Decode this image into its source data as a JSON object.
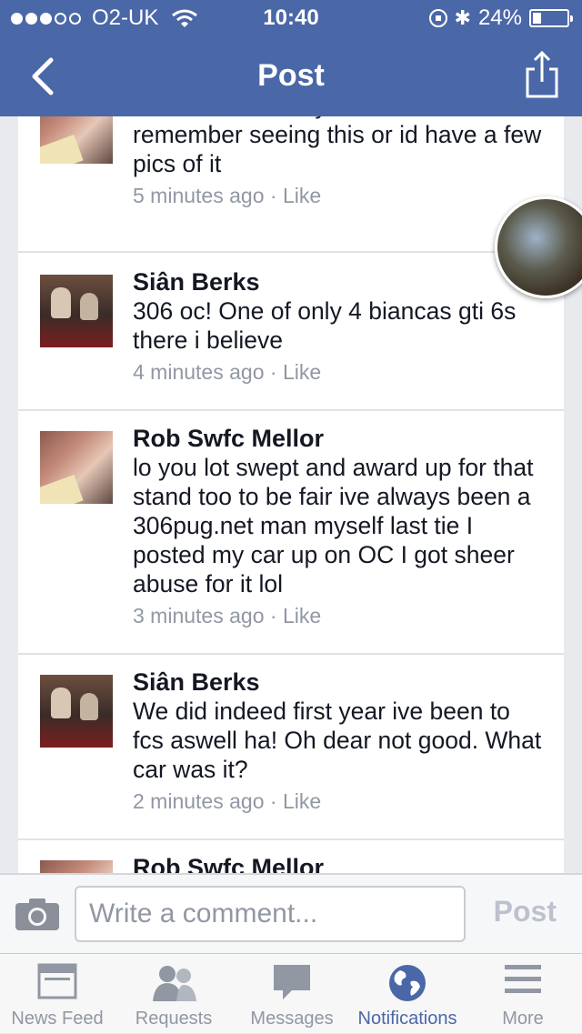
{
  "status_bar": {
    "carrier": "O2-UK",
    "time": "10:40",
    "battery_percent": "24%",
    "battery_level": 0.24,
    "signal_bars_filled": 3,
    "signal_bars_total": 5
  },
  "nav": {
    "title": "Post",
    "back_icon": "chevron-left-icon",
    "share_icon": "share-icon"
  },
  "comments": [
    {
      "name": "",
      "avatar": "baby",
      "text": "what stand were you with cos I don't remember seeing this or id have a few pics of it",
      "time": "5 minutes ago",
      "like": "Like"
    },
    {
      "name": "Siân Berks",
      "avatar": "kids",
      "text": "306 oc! One of only 4 biancas gti 6s there i believe",
      "time": "4 minutes ago",
      "like": "Like"
    },
    {
      "name": "Rob Swfc Mellor",
      "avatar": "baby",
      "text": "lo you lot swept and award up for that stand too to be fair ive always been a 306pug.net man myself last tie I posted my car up on OC I got sheer abuse for it lol",
      "time": "3 minutes ago",
      "like": "Like"
    },
    {
      "name": "Siân Berks",
      "avatar": "kids",
      "text": "We did indeed first year ive been to fcs aswell ha! Oh dear not good. What car was it?",
      "time": "2 minutes ago",
      "like": "Like"
    },
    {
      "name": "Rob Swfc Mellor",
      "avatar": "baby",
      "text": "",
      "time": "",
      "like": ""
    }
  ],
  "composer": {
    "placeholder": "Write a comment...",
    "post_label": "Post",
    "camera_icon": "camera-icon"
  },
  "tabs": [
    {
      "label": "News Feed",
      "icon": "news-feed-icon",
      "active": false
    },
    {
      "label": "Requests",
      "icon": "friend-requests-icon",
      "active": false
    },
    {
      "label": "Messages",
      "icon": "messages-icon",
      "active": false
    },
    {
      "label": "Notifications",
      "icon": "globe-icon",
      "active": true
    },
    {
      "label": "More",
      "icon": "menu-icon",
      "active": false
    }
  ],
  "colors": {
    "brand": "#4a67a7",
    "meta_text": "#9197a3",
    "background": "#e9eaee"
  }
}
